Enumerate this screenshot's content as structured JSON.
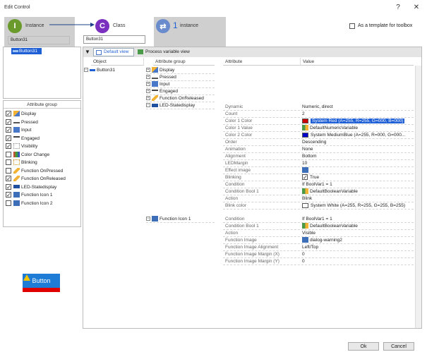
{
  "window": {
    "title": "Edit Control",
    "help": "?",
    "close": "✕"
  },
  "steps": {
    "instance": {
      "label": "Instance",
      "letter": "I",
      "value": "Button31"
    },
    "class": {
      "label": "Class",
      "letter": "C",
      "value": "Button31"
    },
    "count": {
      "label": "instance",
      "number": "1"
    }
  },
  "template_checkbox": {
    "label": "As a template for toolbox",
    "checked": false
  },
  "tree_left": {
    "item": "Button31"
  },
  "attribute_groups": {
    "header": "Attribute group",
    "items": [
      {
        "label": "Display",
        "checked": true,
        "icon": "pencil-icon"
      },
      {
        "label": "Pressed",
        "checked": true,
        "icon": "pressed-icon"
      },
      {
        "label": "Input",
        "checked": true,
        "icon": "input-icon"
      },
      {
        "label": "Engaged",
        "checked": true,
        "icon": "engaged-icon"
      },
      {
        "label": "Visibility",
        "checked": true,
        "icon": "visibility-icon"
      },
      {
        "label": "Color Change",
        "checked": false,
        "icon": "color-change-icon"
      },
      {
        "label": "Blinking",
        "checked": false,
        "icon": "blinking-icon"
      },
      {
        "label": "Function OnPressed",
        "checked": false,
        "icon": "lightning-icon"
      },
      {
        "label": "Function OnReleased",
        "checked": true,
        "icon": "lightning-icon"
      },
      {
        "label": "LED-Statedisplay",
        "checked": true,
        "icon": "led-icon"
      },
      {
        "label": "Function Icon 1",
        "checked": true,
        "icon": "function-icon-icon"
      },
      {
        "label": "Function Icon 2",
        "checked": false,
        "icon": "function-icon-icon"
      }
    ]
  },
  "preview": {
    "button_label": "Button"
  },
  "toolbar": {
    "default_view": "Default view",
    "process_view": "Process variable view"
  },
  "columns": {
    "object": "Object",
    "group": "Attribute group",
    "attribute": "Attribute",
    "value": "Value"
  },
  "object_tree": {
    "item": "Button31"
  },
  "group_tree": [
    {
      "label": "Display",
      "icon": "pencil-icon"
    },
    {
      "label": "Pressed",
      "icon": "pressed-icon"
    },
    {
      "label": "Input",
      "icon": "input-icon"
    },
    {
      "label": "Engaged",
      "icon": "engaged-icon"
    },
    {
      "label": "Function OnReleased",
      "icon": "lightning-icon"
    },
    {
      "label": "LED-Statedisplay",
      "icon": "led-icon"
    }
  ],
  "function_icon_group": {
    "label": "Function Icon 1"
  },
  "led_attributes": [
    {
      "attr": "Dynamic",
      "value": "Numeric, direct"
    },
    {
      "attr": "Count",
      "value": "2"
    },
    {
      "attr": "Color 1 Color",
      "value": "System Red (A=255, R=255, G=000, B=000)",
      "swatch": "#cc0000",
      "selected": true
    },
    {
      "attr": "Color 1 Value",
      "value": "DefaultNumericVariable",
      "icon": "variable-icon"
    },
    {
      "attr": "Color 2 Color",
      "value": "System MediumBlue (A=255, R=000, G=000...",
      "swatch": "#0000cd"
    },
    {
      "attr": "Order",
      "value": "Descending"
    },
    {
      "attr": "Animation",
      "value": "None"
    },
    {
      "attr": "Alignment",
      "value": "Bottom"
    },
    {
      "attr": "LEDMargin",
      "value": "10"
    },
    {
      "attr": "Effect image",
      "value": "",
      "icon": "image-icon"
    },
    {
      "attr": "Blinking",
      "value": "True",
      "check": true
    },
    {
      "attr": "Condition",
      "value": "If BoolVar1 = 1"
    },
    {
      "attr": "Condition Bool 1",
      "value": "DefaultBooleanVariable",
      "icon": "variable-icon"
    },
    {
      "attr": "Action",
      "value": "Blink"
    },
    {
      "attr": "Blink color",
      "value": "System White (A=255, R=255, G=255, B=255)",
      "swatch": "#ffffff"
    }
  ],
  "fi_attributes": [
    {
      "attr": "Condition",
      "value": "If BoolVar1 = 1"
    },
    {
      "attr": "Condition Bool 1",
      "value": "DefaultBooleanVariable",
      "icon": "variable-icon"
    },
    {
      "attr": "Action",
      "value": "Visible"
    },
    {
      "attr": "Function Image",
      "value": "dialog-warning2",
      "icon": "image-icon"
    },
    {
      "attr": "Function Image Alignment",
      "value": "Left/Top"
    },
    {
      "attr": "Function Image Margin (X)",
      "value": "0"
    },
    {
      "attr": "Function Image Margin (Y)",
      "value": "0"
    }
  ],
  "footer": {
    "ok": "Ok",
    "cancel": "Cancel"
  },
  "colors": {
    "instance_circle": "#6b9a2c",
    "class_circle": "#7b2fbf",
    "count_circle": "#6a8ccc",
    "selected_bg": "#1f5fd6",
    "preview_btn": "#1e7bd6",
    "preview_bar": "#e00000"
  }
}
